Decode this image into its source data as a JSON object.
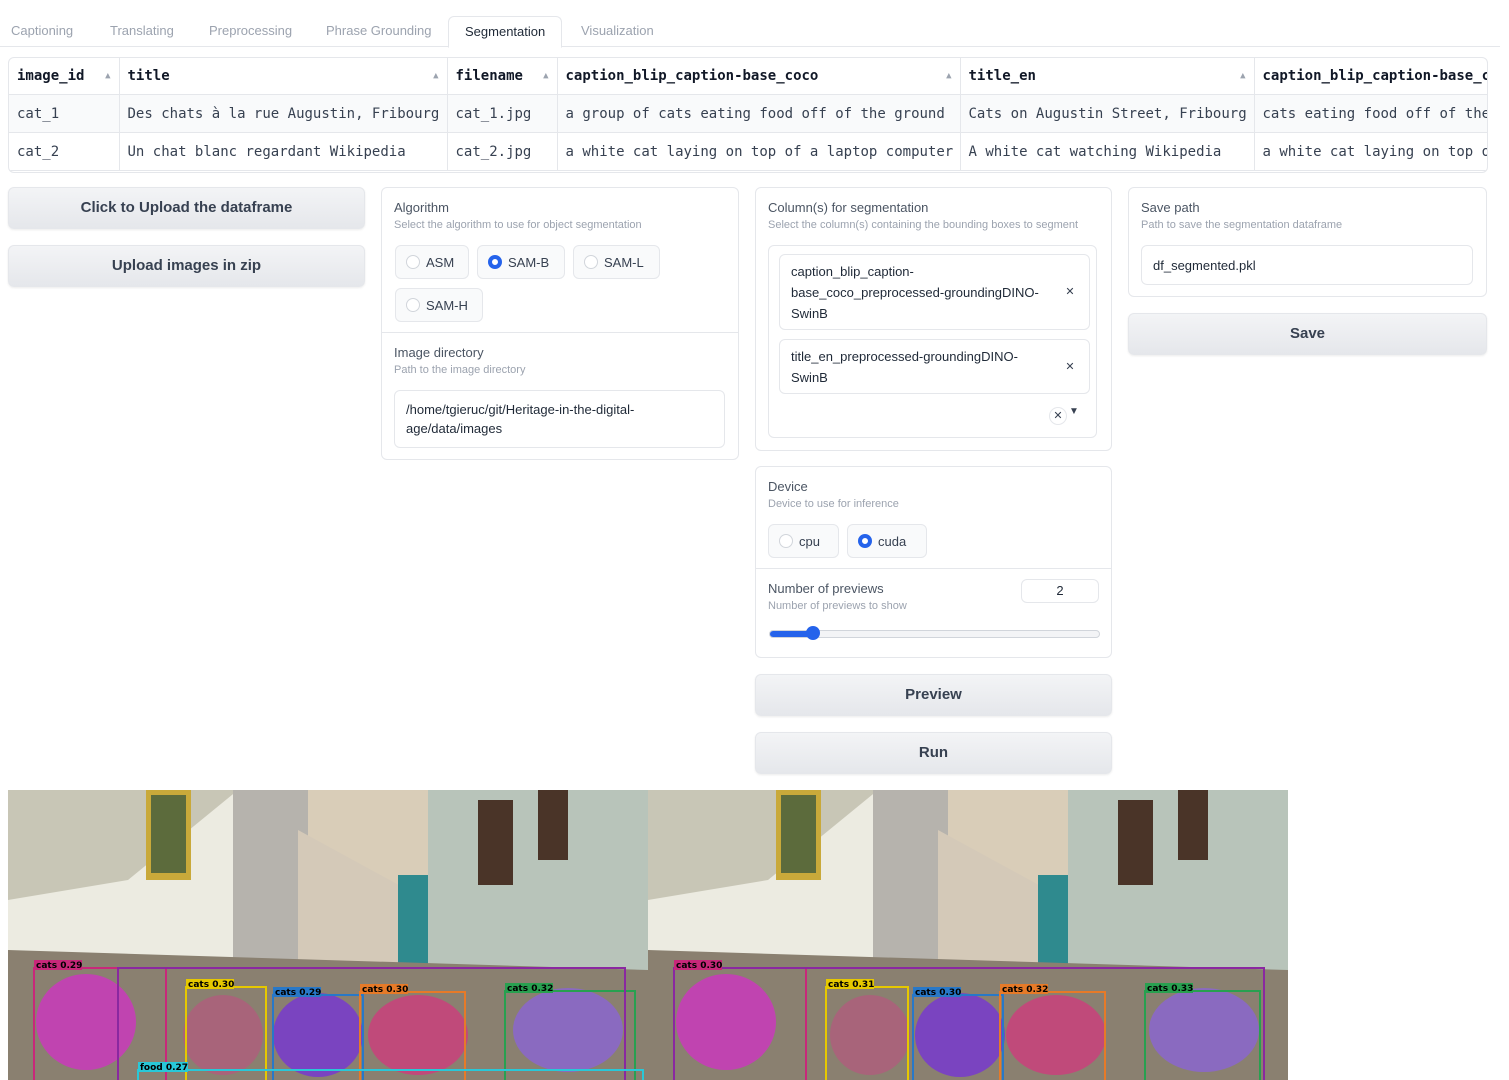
{
  "tabs": [
    "Captioning",
    "Translating",
    "Preprocessing",
    "Phrase Grounding",
    "Segmentation",
    "Visualization"
  ],
  "table": {
    "headers": [
      "image_id",
      "title",
      "filename",
      "caption_blip_caption-base_coco",
      "title_en",
      "caption_blip_caption-base_c"
    ],
    "rows": [
      [
        "cat_1",
        "Des chats à la rue Augustin, Fribourg",
        "cat_1.jpg",
        "a group of cats eating food off of the ground",
        "Cats on Augustin Street, Fribourg",
        "cats eating food off of the"
      ],
      [
        "cat_2",
        "Un chat blanc regardant Wikipedia",
        "cat_2.jpg",
        "a white cat laying on top of a laptop computer",
        "A white cat watching Wikipedia",
        "a white cat laying on top o"
      ]
    ]
  },
  "buttons": {
    "upload_df": "Click to Upload the dataframe",
    "upload_zip": "Upload images in zip",
    "save": "Save",
    "preview": "Preview",
    "run": "Run"
  },
  "algorithm": {
    "label": "Algorithm",
    "info": "Select the algorithm to use for object segmentation",
    "options": [
      "ASM",
      "SAM-B",
      "SAM-L",
      "SAM-H"
    ],
    "selected": "SAM-B"
  },
  "image_dir": {
    "label": "Image directory",
    "info": "Path to the image directory",
    "value": "/home/tgieruc/git/Heritage-in-the-digital-age/data/images"
  },
  "columns": {
    "label": "Column(s) for segmentation",
    "info": "Select the column(s) containing the bounding boxes to segment",
    "chips": [
      "caption_blip_caption-base_coco_preprocessed-groundingDINO-SwinB",
      "title_en_preprocessed-groundingDINO-SwinB"
    ]
  },
  "save_path": {
    "label": "Save path",
    "info": "Path to save the segmentation dataframe",
    "value": "df_segmented.pkl"
  },
  "device": {
    "label": "Device",
    "info": "Device to use for inference",
    "options": [
      "cpu",
      "cuda"
    ],
    "selected": "cuda"
  },
  "previews": {
    "label": "Number of previews",
    "info": "Number of previews to show",
    "value": "2",
    "fraction": 0.13
  },
  "gallery": [
    {
      "boxes": [
        {
          "label": "cats 0.29"
        },
        {
          "label": "cats 0.30"
        },
        {
          "label": "cats 0.29"
        },
        {
          "label": "cats 0.30"
        },
        {
          "label": "cats 0.32"
        },
        {
          "label": "food 0.27"
        }
      ]
    },
    {
      "boxes": [
        {
          "label": "cats 0.30"
        },
        {
          "label": "cats 0.31"
        },
        {
          "label": "cats 0.30"
        },
        {
          "label": "cats 0.32"
        },
        {
          "label": "cats 0.33"
        }
      ]
    }
  ],
  "colors": {
    "accent": "#2563eb",
    "border": "#e5e7eb"
  }
}
